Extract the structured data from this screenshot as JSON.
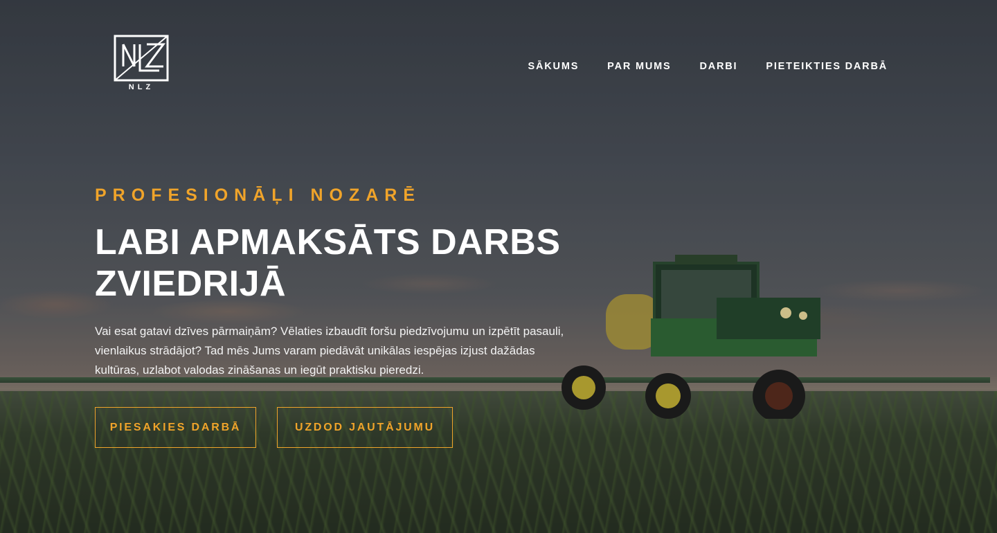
{
  "brand": {
    "logo_text": "NLZ"
  },
  "nav": {
    "items": [
      {
        "label": "SĀKUMS"
      },
      {
        "label": "PAR MUMS"
      },
      {
        "label": "DARBI"
      },
      {
        "label": "PIETEIKTIES DARBĀ"
      }
    ]
  },
  "hero": {
    "eyebrow": "PROFESIONĀĻI NOZARĒ",
    "headline_line1": "LABI APMAKSĀTS DARBS",
    "headline_line2": "ZVIEDRIJĀ",
    "intro_line1": "Vai esat gatavi dzīves pārmaiņām? Vēlaties izbaudīt foršu piedzīvojumu un izpētīt pasauli,",
    "intro_line2": "vienlaikus strādājot? Tad mēs Jums varam piedāvāt unikālas iespējas izjust dažādas",
    "intro_line3": "kultūras, uzlabot valodas zināšanas un iegūt praktisku pieredzi.",
    "primary_button": "PIESAKIES DARBĀ",
    "secondary_button": "UZDOD JAUTĀJUMU"
  },
  "colors": {
    "accent": "#f0a42a",
    "text": "#ffffff"
  }
}
